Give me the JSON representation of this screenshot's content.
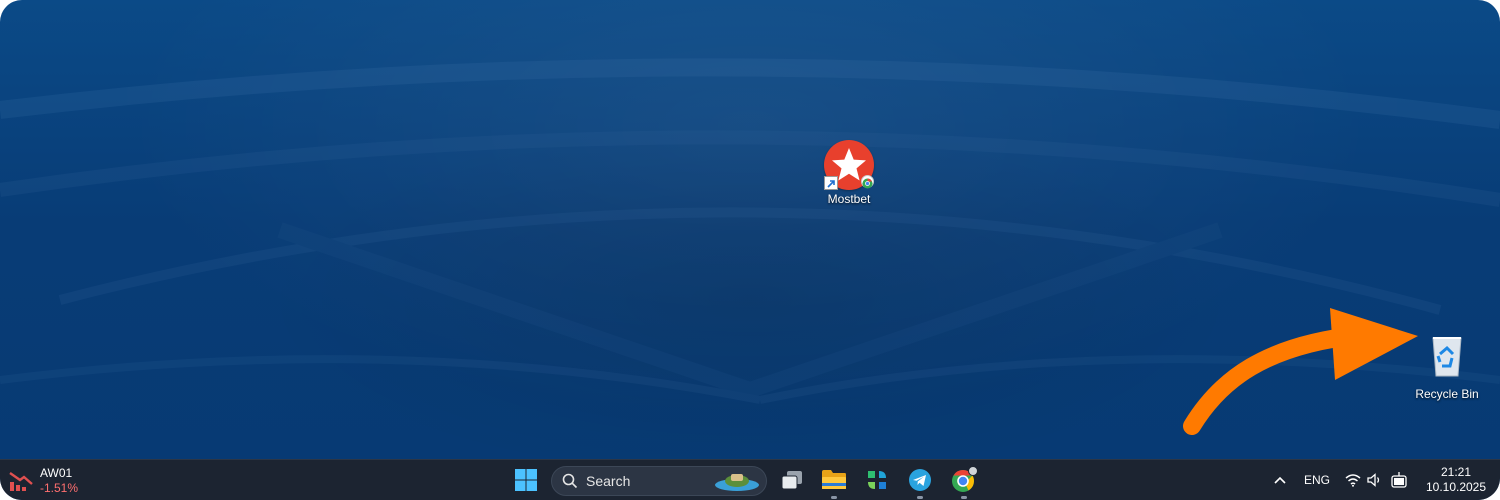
{
  "desktop": {
    "icons": [
      {
        "label": "Mostbet",
        "icon": "mostbet-star-icon"
      },
      {
        "label": "Recycle Bin",
        "icon": "recycle-bin-icon"
      }
    ],
    "annotation": {
      "type": "arrow",
      "color": "#ff7a00",
      "points_to": "Recycle Bin"
    }
  },
  "taskbar": {
    "stock_widget": {
      "symbol": "AW01",
      "change": "-1.51%",
      "trend_icon": "stock-down-icon",
      "change_color": "#ff6f6f"
    },
    "search": {
      "placeholder": "Search"
    },
    "pinned_apps": [
      "windows-start-icon",
      "task-view-icon",
      "file-explorer-icon",
      "copilot-icon",
      "telegram-icon",
      "chrome-icon"
    ],
    "tray": {
      "language": "ENG",
      "icons": [
        "show-hidden-chevron-icon",
        "wifi-icon",
        "volume-icon",
        "battery-icon"
      ]
    },
    "clock": {
      "time": "21:21",
      "date": "10.10.2025"
    }
  },
  "colors": {
    "desktop_background": "#083c76",
    "taskbar": "#1c2431",
    "mostbet_red": "#e8402d",
    "arrow_orange": "#ff7a00"
  }
}
